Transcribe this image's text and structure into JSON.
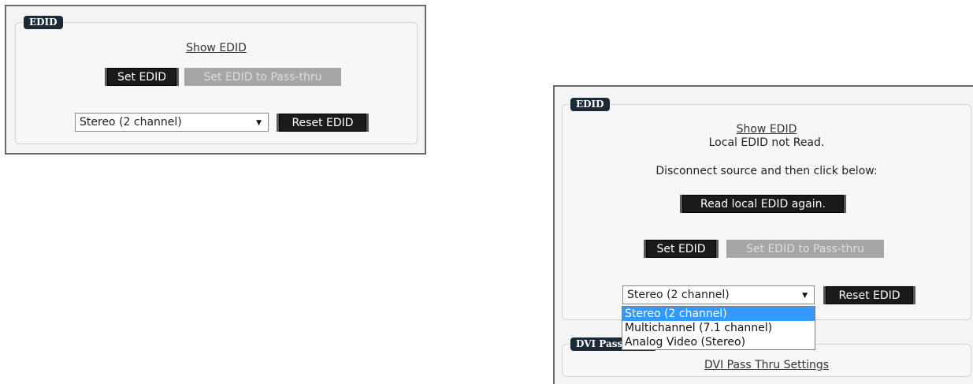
{
  "panel_a": {
    "legend": "EDID",
    "show_edid": "Show EDID",
    "set_edid": "Set EDID",
    "set_pass_thru": "Set EDID to Pass-thru",
    "select_value": "Stereo (2 channel)",
    "reset_edid": "Reset EDID"
  },
  "panel_b": {
    "legend": "EDID",
    "show_edid": "Show EDID",
    "status": "Local EDID not Read.",
    "instruction": "Disconnect source and then click below:",
    "read_again": "Read local EDID again.",
    "set_edid": "Set EDID",
    "set_pass_thru": "Set EDID to Pass-thru",
    "select_value": "Stereo (2 channel)",
    "reset_edid": "Reset EDID",
    "options": [
      "Stereo (2 channel)",
      "Multichannel (7.1 channel)",
      "Analog Video (Stereo)"
    ],
    "dvi_legend": "DVI Pass Thru",
    "dvi_link": "DVI Pass Thru Settings"
  },
  "icons": {
    "dropdown_arrow": "chevron-down-icon",
    "dropdown_glyph": "▼"
  },
  "colors": {
    "legend_bg": "#1c2a38",
    "button_bg": "#1a1a1a",
    "disabled_bg": "#a6a6a6",
    "selected_option": "#3399ff"
  }
}
